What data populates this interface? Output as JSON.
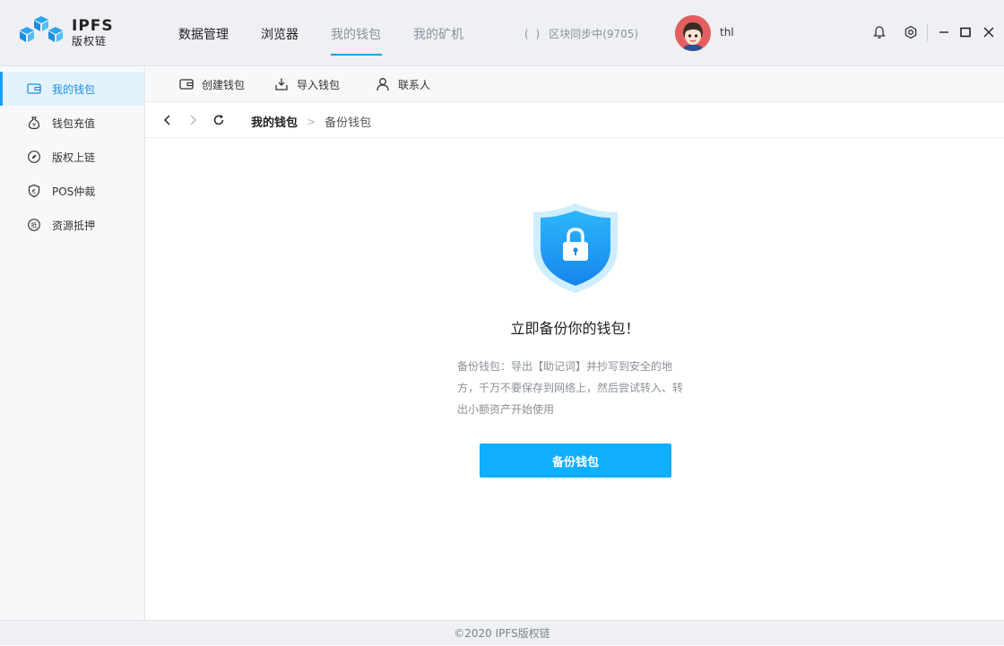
{
  "app": {
    "logo_title": "IPFS",
    "logo_subtitle": "版权链",
    "logo_icon": "cubes-logo-icon"
  },
  "nav": {
    "tabs": [
      {
        "label": "数据管理",
        "state": "normal"
      },
      {
        "label": "浏览器",
        "state": "normal"
      },
      {
        "label": "我的钱包",
        "state": "active"
      },
      {
        "label": "我的矿机",
        "state": "dim"
      }
    ]
  },
  "status": {
    "sync_text": "区块同步中(9705)",
    "sync_icon": "sync-spinner-icon"
  },
  "user": {
    "name": "thl",
    "avatar_icon": "cartoon-avatar"
  },
  "window_controls": {
    "icons": [
      "bell-icon",
      "settings-icon",
      "minimize-icon",
      "maximize-icon",
      "close-icon"
    ]
  },
  "sidebar": {
    "items": [
      {
        "label": "我的钱包",
        "icon": "wallet-icon",
        "active": true
      },
      {
        "label": "钱包充值",
        "icon": "money-bag-icon",
        "active": false
      },
      {
        "label": "版权上链",
        "icon": "compass-icon",
        "active": false
      },
      {
        "label": "POS仲裁",
        "icon": "shield-coin-icon",
        "active": false
      },
      {
        "label": "资源抵押",
        "icon": "pledge-icon",
        "active": false
      }
    ]
  },
  "toolbar": {
    "create_label": "创建钱包",
    "import_label": "导入钱包",
    "contacts_label": "联系人"
  },
  "breadcrumb": {
    "parent": "我的钱包",
    "separator": ">",
    "current": "备份钱包"
  },
  "main": {
    "headline": "立即备份你的钱包！",
    "description": "备份钱包：导出【助记词】并抄写到安全的地方，千万不要保存到网络上，然后尝试转入、转出小额资产开始使用",
    "button_label": "备份钱包"
  },
  "footer": {
    "copyright": "©2020 IPFS版权链"
  },
  "colors": {
    "accent": "#1b9cf2",
    "button": "#0faeff",
    "topbar_bg": "#eef0f4",
    "sidebar_active_bg": "#e3f3fd"
  }
}
